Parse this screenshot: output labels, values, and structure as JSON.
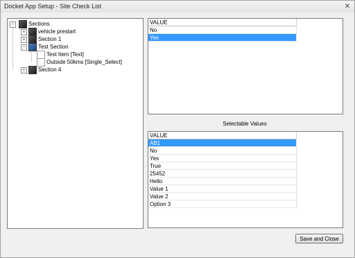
{
  "window": {
    "title": "Docket App Setup - Site Check List",
    "close_glyph": "✕"
  },
  "tree": {
    "root": "Sections",
    "items": [
      {
        "label": "vehicle prestart"
      },
      {
        "label": "Section 1"
      },
      {
        "label": "Test Section",
        "children": [
          {
            "label": "Test Item   [Text]"
          },
          {
            "label": "Outside 50kms   [Single_Select]"
          }
        ]
      },
      {
        "label": "Section 4"
      }
    ]
  },
  "top_grid": {
    "header": "VALUE",
    "rows": [
      "No",
      "Yes"
    ],
    "selected": "Yes"
  },
  "selectable_label": "Selectable Values",
  "bottom_grid": {
    "header": "VALUE",
    "rows": [
      "AB1",
      "No",
      "Yes",
      "True",
      "25452",
      "Hello",
      "Value 1",
      "Value 2",
      "Option 3"
    ],
    "selected": "AB1"
  },
  "buttons": {
    "save_close": "Save and Close"
  },
  "colors": {
    "selection": "#3399ff"
  }
}
